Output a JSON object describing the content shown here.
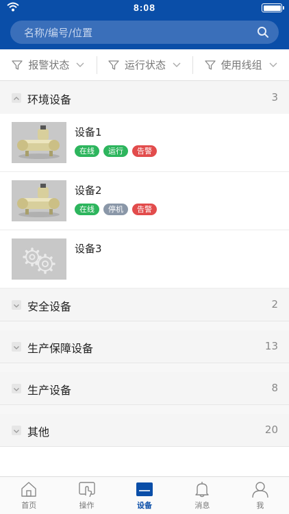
{
  "status_bar": {
    "time": "8:08"
  },
  "search": {
    "placeholder": "名称/编号/位置"
  },
  "filters": [
    {
      "label": "报警状态"
    },
    {
      "label": "运行状态"
    },
    {
      "label": "使用线组"
    }
  ],
  "groups": [
    {
      "name": "环境设备",
      "count": "3",
      "expanded": true
    },
    {
      "name": "安全设备",
      "count": "2",
      "expanded": false
    },
    {
      "name": "生产保障设备",
      "count": "13",
      "expanded": false
    },
    {
      "name": "生产设备",
      "count": "8",
      "expanded": false
    },
    {
      "name": "其他",
      "count": "20",
      "expanded": false
    }
  ],
  "devices": [
    {
      "name": "设备1",
      "badges": [
        {
          "text": "在线",
          "color": "#2db55d"
        },
        {
          "text": "运行",
          "color": "#2db55d"
        },
        {
          "text": "告警",
          "color": "#e24c4c"
        }
      ]
    },
    {
      "name": "设备2",
      "badges": [
        {
          "text": "在线",
          "color": "#2db55d"
        },
        {
          "text": "停机",
          "color": "#8a97a8"
        },
        {
          "text": "告警",
          "color": "#e24c4c"
        }
      ]
    },
    {
      "name": "设备3",
      "badges": []
    }
  ],
  "tabbar": [
    {
      "label": "首页",
      "icon": "home-icon",
      "active": false
    },
    {
      "label": "操作",
      "icon": "touch-icon",
      "active": false
    },
    {
      "label": "设备",
      "icon": "device-icon",
      "active": true
    },
    {
      "label": "消息",
      "icon": "bell-icon",
      "active": false
    },
    {
      "label": "我",
      "icon": "person-icon",
      "active": false
    }
  ],
  "colors": {
    "primary": "#0a4ea8",
    "online": "#2db55d",
    "stopped": "#8a97a8",
    "alarm": "#e24c4c"
  }
}
